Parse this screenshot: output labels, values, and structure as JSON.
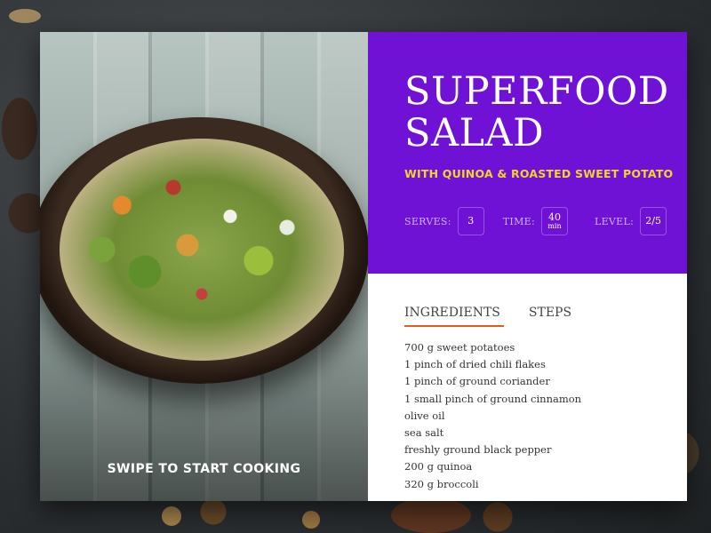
{
  "hero": {
    "swipe_text": "SWIPE TO START COOKING"
  },
  "recipe": {
    "title_line1": "SUPERFOOD",
    "title_line2": "SALAD",
    "subtitle": "WITH QUINOA & ROASTED SWEET POTATO",
    "stats": {
      "serves_label": "SERVES:",
      "serves_value": "3",
      "time_label": "TIME:",
      "time_value": "40",
      "time_unit": "min",
      "level_label": "LEVEL:",
      "level_value": "2/5"
    }
  },
  "tabs": [
    {
      "label": "INGREDIENTS",
      "active": true
    },
    {
      "label": "STEPS",
      "active": false
    }
  ],
  "ingredients": [
    "700  g sweet potatoes",
    "1 pinch of dried chili flakes",
    "1 pinch of ground coriander",
    "1 small pinch of ground cinnamon",
    "olive oil",
    "sea salt",
    "freshly ground black pepper",
    "200 g quinoa",
    "320 g broccoli"
  ],
  "colors": {
    "accent_purple": "#7012d6",
    "subtitle_yellow": "#f5d32a",
    "tab_underline": "#e35b1e"
  }
}
